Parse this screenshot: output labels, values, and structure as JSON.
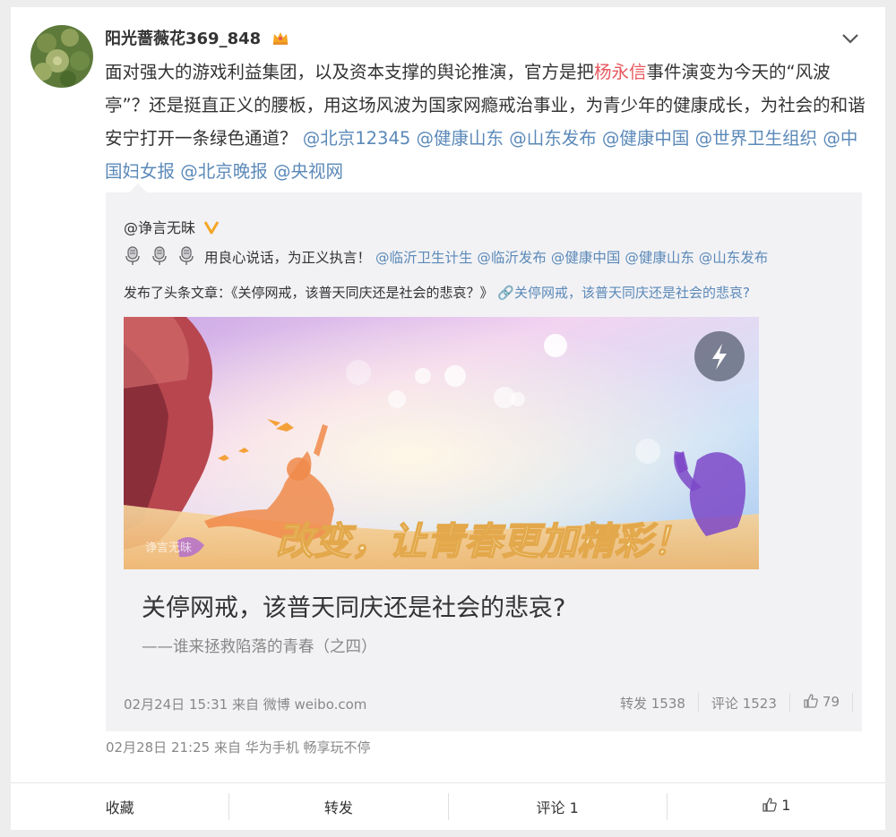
{
  "post": {
    "username": "阳光蔷薇花369_848",
    "text_1": "面对强大的游戏利益集团，以及资本支撑的舆论推演，官方是把",
    "text_highlight": "杨永信",
    "text_2": "事件演变为今天的“风波亭”？还是挺直正义的腰板，用这场风波为国家网瘾戒治事业，为青少年的健康成长，为社会的和谐安宁打开一条绿色通道？",
    "mentions": [
      "@北京12345",
      "@健康山东",
      "@山东发布",
      "@健康中国",
      "@世界卫生组织",
      "@中国妇女报",
      "@北京晚报",
      "@央视网"
    ],
    "time": "02月28日 21:25",
    "source_prefix": "来自",
    "source": "华为手机 畅享玩不停"
  },
  "repost": {
    "user": "@诤言无昧",
    "line1_text": "用良心说话，为正义执言！",
    "line1_mentions": [
      "@临沂卫生计生",
      "@临沂发布",
      "@健康中国",
      "@健康山东",
      "@山东发布"
    ],
    "article_prefix": "发布了头条文章：《关停网戒，该普天同庆还是社会的悲哀？》",
    "article_link": "关停网戒，该普天同庆还是社会的悲哀?",
    "banner_text": "改变，让青春更加精彩！",
    "banner_watermark": "诤言无昧",
    "article_title": "关停网戒，该普天同庆还是社会的悲哀?",
    "article_subtitle": "——谁来拯救陷落的青春（之四）",
    "time": "02月24日 15:31",
    "source_prefix": "来自",
    "source": "微博 weibo.com",
    "repost_label": "转发",
    "repost_count": "1538",
    "comment_label": "评论",
    "comment_count": "1523",
    "like_count": "79"
  },
  "actions": {
    "favorite": "收藏",
    "repost": "转发",
    "comment": "评论 1",
    "like": "1"
  },
  "colors": {
    "link": "#5b89b8",
    "highlight": "#e8575d",
    "verified_badge": "#f5a623"
  }
}
